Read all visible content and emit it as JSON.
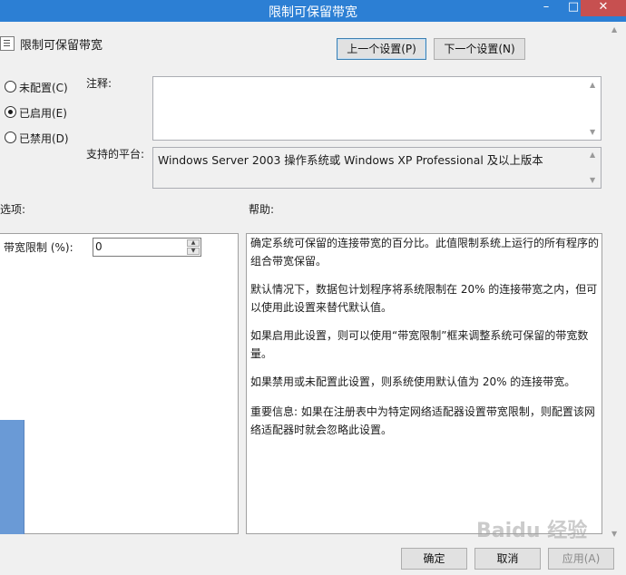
{
  "window": {
    "title": "限制可保留带宽",
    "minimize": "–",
    "maximize": "□",
    "close": "✕"
  },
  "header": {
    "policy_title": "限制可保留带宽",
    "prev_button": "上一个设置(P)",
    "next_button": "下一个设置(N)"
  },
  "state": {
    "options": [
      {
        "label": "未配置(C)",
        "checked": false
      },
      {
        "label": "已启用(E)",
        "checked": true
      },
      {
        "label": "已禁用(D)",
        "checked": false
      }
    ]
  },
  "comment": {
    "label": "注释:",
    "value": ""
  },
  "platform": {
    "label": "支持的平台:",
    "value": "Windows Server 2003 操作系统或 Windows XP Professional 及以上版本"
  },
  "options_section": {
    "label": "选项:",
    "bandwidth_label": "带宽限制 (%):",
    "bandwidth_value": "0"
  },
  "help_section": {
    "label": "帮助:",
    "paragraphs": [
      "确定系统可保留的连接带宽的百分比。此值限制系统上运行的所有程序的组合带宽保留。",
      "默认情况下，数据包计划程序将系统限制在 20% 的连接带宽之内，但可以使用此设置来替代默认值。",
      "如果启用此设置，则可以使用“带宽限制”框来调整系统可保留的带宽数量。",
      "如果禁用或未配置此设置，则系统使用默认值为 20% 的连接带宽。",
      "重要信息: 如果在注册表中为特定网络适配器设置带宽限制，则配置该网络适配器时就会忽略此设置。"
    ]
  },
  "footer": {
    "ok": "确定",
    "cancel": "取消",
    "apply": "应用(A)"
  },
  "watermark": "Baidu 经验",
  "colors": {
    "titlebar": "#2c7fd4",
    "close_button": "#c75050",
    "window_bg": "#f0f0f0"
  }
}
